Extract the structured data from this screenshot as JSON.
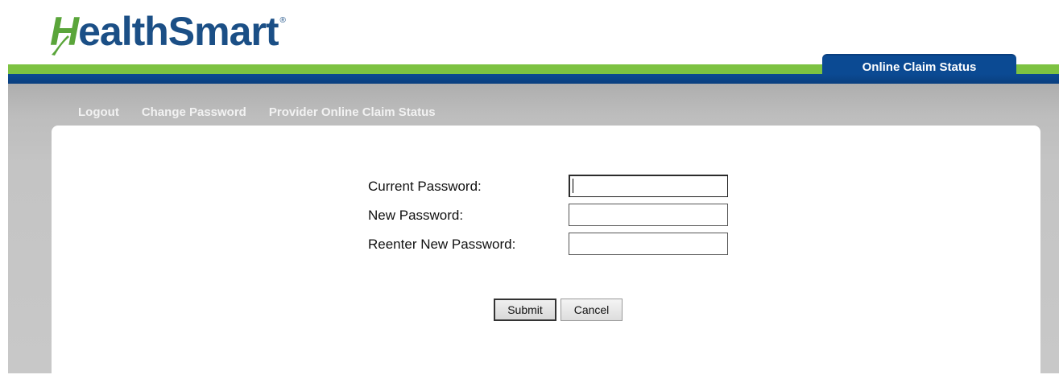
{
  "header": {
    "brand": {
      "h_letter": "H",
      "rest": "ealthSmart",
      "mark": "®"
    },
    "active_tab": "Online Claim Status"
  },
  "nav": {
    "items": [
      {
        "label": "Logout"
      },
      {
        "label": "Change Password"
      },
      {
        "label": "Provider Online Claim Status"
      }
    ]
  },
  "form": {
    "current_password_label": "Current Password:",
    "new_password_label": "New Password:",
    "reenter_password_label": "Reenter New Password:",
    "current_password_value": "",
    "new_password_value": "",
    "reenter_password_value": ""
  },
  "buttons": {
    "submit": "Submit",
    "cancel": "Cancel"
  },
  "colors": {
    "brand_blue": "#1b4f86",
    "brand_green": "#5aa53a",
    "bar_green": "#7dc242",
    "bar_blue": "#0b4a93"
  }
}
